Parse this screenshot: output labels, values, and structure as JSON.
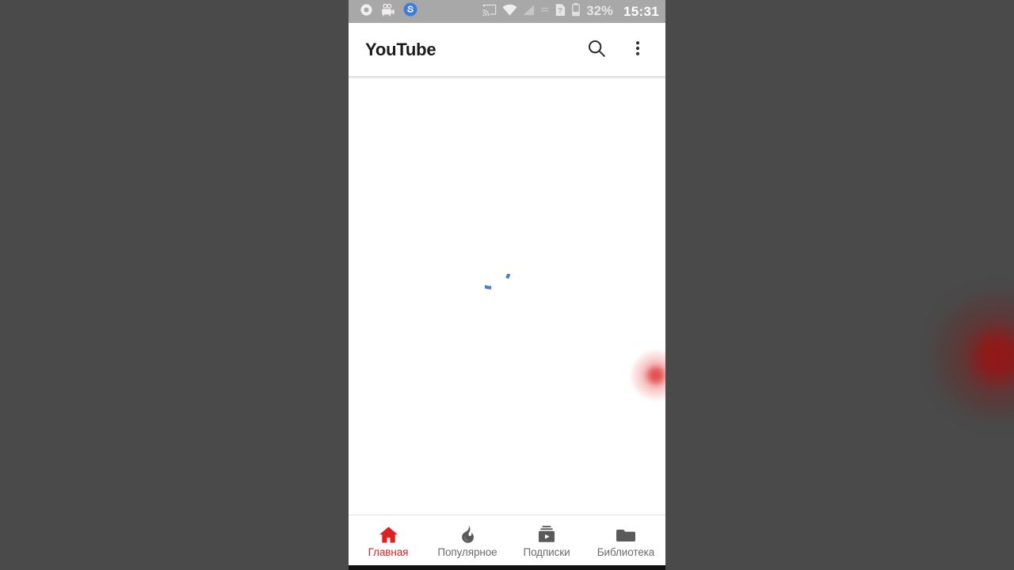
{
  "device": {
    "background_color": "#4a4a4a",
    "screen_background": "#ffffff"
  },
  "status_bar": {
    "background_color": "#a8a8a8",
    "left_icons": [
      {
        "name": "screen-record-icon",
        "glyph": "record"
      },
      {
        "name": "video-camera-icon",
        "glyph": "camcorder"
      },
      {
        "name": "skype-icon",
        "glyph": "s-badge",
        "color": "#2f6fd0"
      }
    ],
    "right_icons": [
      {
        "name": "cast-icon",
        "glyph": "cast"
      },
      {
        "name": "wifi-icon",
        "glyph": "wifi"
      },
      {
        "name": "signal-icon",
        "glyph": "signal"
      },
      {
        "name": "vibrate-icon",
        "glyph": "lines"
      },
      {
        "name": "sim-card-icon",
        "glyph": "sim-question"
      },
      {
        "name": "battery-icon",
        "glyph": "battery"
      }
    ],
    "battery_percent": "32%",
    "clock": "15:31"
  },
  "app_bar": {
    "title": "YouTube",
    "search_icon": "search-icon",
    "overflow_icon": "more-vert-icon"
  },
  "content": {
    "state": "loading",
    "spinner": {
      "name": "loading-spinner",
      "color": "#4a7fd0",
      "arc_degrees": 280
    },
    "touch_indicator": {
      "name": "touch-indicator",
      "color": "#e24646"
    }
  },
  "bottom_nav": {
    "active_color": "#d32222",
    "inactive_color": "#6b6b6b",
    "items": [
      {
        "label": "Главная",
        "icon": "home-icon",
        "active": true
      },
      {
        "label": "Популярное",
        "icon": "trending-flame-icon",
        "active": false
      },
      {
        "label": "Подписки",
        "icon": "subscriptions-icon",
        "active": false
      },
      {
        "label": "Библиотека",
        "icon": "library-folder-icon",
        "active": false
      }
    ]
  }
}
